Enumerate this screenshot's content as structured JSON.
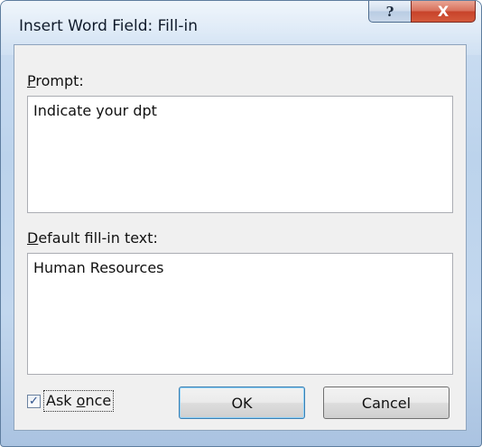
{
  "window": {
    "title": "Insert Word Field: Fill-in",
    "help_label": "?",
    "close_label": "X"
  },
  "prompt": {
    "label_accel": "P",
    "label_rest": "rompt:",
    "value": "Indicate your dpt"
  },
  "default_text": {
    "label_accel": "D",
    "label_rest": "efault fill-in text:",
    "value": "Human Resources"
  },
  "ask_once": {
    "checked": true,
    "check_glyph": "✓",
    "label_pre": "Ask ",
    "label_accel": "o",
    "label_rest": "nce"
  },
  "buttons": {
    "ok_label": "OK",
    "cancel_label": "Cancel"
  }
}
